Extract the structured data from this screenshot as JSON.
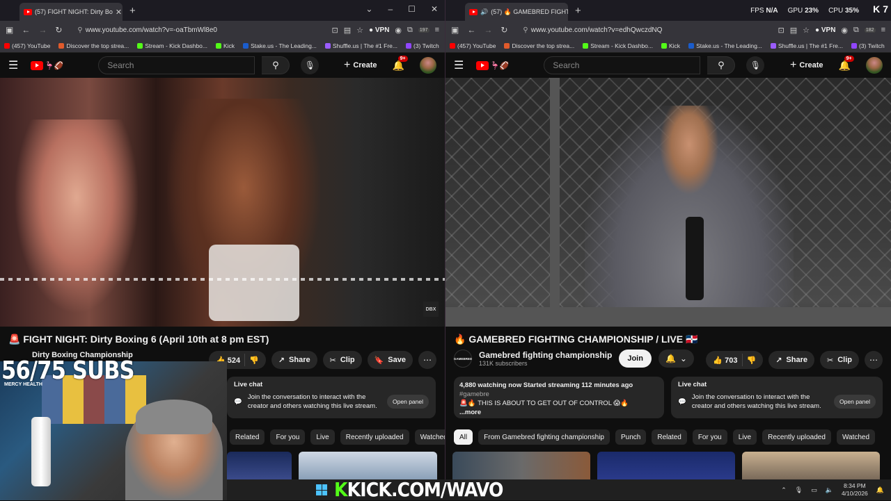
{
  "left": {
    "tab_title": "(57) FIGHT NIGHT: Dirty Bo",
    "url": "www.youtube.com/watch?v=-oaTbmWl8e0",
    "ext_badge": "197",
    "video_title": "FIGHT NIGHT: Dirty Boxing 6 (April 10th at 8 pm EST)",
    "title_emoji": "🚨",
    "channel_name": "Dirty Boxing Championship",
    "likes": "524",
    "share": "Share",
    "clip": "Clip",
    "save": "Save",
    "live_chat": "Live chat",
    "chat_text": "Join the conversation to interact with the creator and others watching this live stream.",
    "open_panel": "Open panel",
    "chips": [
      "Related",
      "For you",
      "Live",
      "Recently uploaded",
      "Watched"
    ],
    "video_logo": "DBX"
  },
  "right": {
    "tab_title": "(57) 🔥 GAMEBRED FIGHTIN",
    "url": "www.youtube.com/watch?v=edhQwczdNQ",
    "ext_badge": "182",
    "video_title": "GAMEBRED FIGHTING CHAMPIONSHIP / LIVE",
    "title_emoji": "🔥",
    "title_flag": "🇩🇴",
    "channel_name": "Gamebred fighting championship",
    "subs": "131K subscribers",
    "join": "Join",
    "likes": "703",
    "share": "Share",
    "clip": "Clip",
    "desc_line1": "4,880 watching now  Started streaming 112 minutes ago",
    "desc_tag": "#gamebre",
    "desc_line2": "🚨🔥 THIS IS ABOUT TO GET OUT OF CONTROL 😱🔥",
    "desc_more": "...more",
    "live_chat": "Live chat",
    "chat_text": "Join the conversation to interact with the creator and others watching this live stream.",
    "open_panel": "Open panel",
    "chips": [
      "All",
      "From Gamebred fighting championship",
      "Punch",
      "Related",
      "For you",
      "Live",
      "Recently uploaded",
      "Watched"
    ],
    "channel_logo": "GAMEBRED"
  },
  "common": {
    "vpn": "VPN",
    "search_placeholder": "Search",
    "create": "Create",
    "notif_badge": "9+",
    "bookmarks": [
      "(457) YouTube",
      "Discover the top strea...",
      "Stream - Kick Dashbo...",
      "Kick",
      "Stake.us - The Leading...",
      "Shuffle.us | The #1 Fre...",
      "(3) Twitch"
    ]
  },
  "overlay": {
    "sub_goal": "56/75 SUBS",
    "kick_url": "KICK.COM/WAVO",
    "kick_k": "K",
    "fps_label": "FPS",
    "fps_val": "N/A",
    "gpu_label": "GPU",
    "gpu_val": "23%",
    "cpu_label": "CPU",
    "cpu_val": "35%",
    "k7": "7",
    "webcam_sign": "MERCY HEALTH"
  },
  "taskbar": {
    "time": "8:34 PM",
    "date": "4/10/2026"
  },
  "colors": {
    "yt_red": "#ff0000",
    "kick_green": "#53fc18",
    "bg": "#0f0f0f"
  }
}
